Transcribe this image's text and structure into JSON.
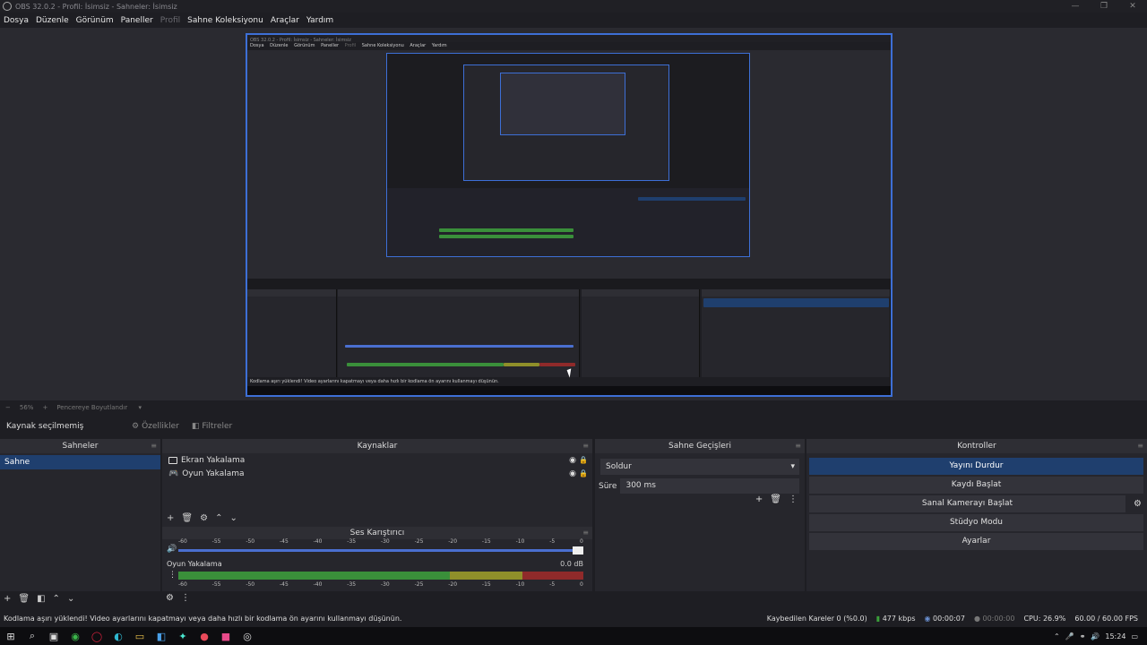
{
  "window": {
    "title": "OBS 32.0.2 - Profil: İsimsiz - Sahneler: İsimsiz",
    "min": "—",
    "max": "❐",
    "close": "✕"
  },
  "menu": [
    "Dosya",
    "Düzenle",
    "Görünüm",
    "Paneller",
    "Profil",
    "Sahne Koleksiyonu",
    "Araçlar",
    "Yardım"
  ],
  "zoom": {
    "minus": "−",
    "value": "56%",
    "plus": "+",
    "mode": "Pencereye Boyutlandır"
  },
  "source_toolbar": {
    "selection": "Kaynak seçilmemiş",
    "properties": "Özellikler",
    "filters": "Filtreler"
  },
  "scenes": {
    "title": "Sahneler",
    "items": [
      "Sahne"
    ]
  },
  "sources": {
    "title": "Kaynaklar",
    "items": [
      {
        "name": "Ekran Yakalama"
      },
      {
        "name": "Oyun Yakalama"
      }
    ]
  },
  "mixer": {
    "title": "Ses Karıştırıcı",
    "ticks": [
      "-60",
      "-55",
      "-50",
      "-45",
      "-40",
      "-35",
      "-30",
      "-25",
      "-20",
      "-15",
      "-10",
      "-5",
      "0"
    ],
    "channel": {
      "name": "Oyun Yakalama",
      "db": "0.0 dB",
      "level": 0.85
    }
  },
  "transitions": {
    "title": "Sahne Geçişleri",
    "type": "Soldur",
    "duration_label": "Süre",
    "duration": "300 ms"
  },
  "controls": {
    "title": "Kontroller",
    "buttons": [
      "Yayını Durdur",
      "Kaydı Başlat",
      "Sanal Kamerayı Başlat",
      "Stüdyo Modu",
      "Ayarlar"
    ]
  },
  "status": {
    "message": "Kodlama aşırı yüklendi! Video ayarlarını kapatmayı veya daha hızlı bir kodlama ön ayarını kullanmayı düşünün.",
    "dropped": "Kaybedilen Kareler 0 (%0.0)",
    "bitrate": "477 kbps",
    "stream_time": "00:00:07",
    "rec_time": "00:00:00",
    "cpu": "CPU: 26.9%",
    "fps": "60.00 / 60.00 FPS"
  },
  "taskbar": {
    "time": "15:24"
  },
  "preview": {
    "title": "OBS 32.0.2 - Profil: İsimsiz - Sahneler: İsimsiz",
    "menu": [
      "Dosya",
      "Düzenle",
      "Görünüm",
      "Paneller",
      "Profil",
      "Sahne Koleksiyonu",
      "Araçlar",
      "Yardım"
    ],
    "status": "Kodlama aşırı yüklendi! Video ayarlarını kapatmayı veya daha hızlı bir kodlama ön ayarını kullanmayı düşünün."
  }
}
